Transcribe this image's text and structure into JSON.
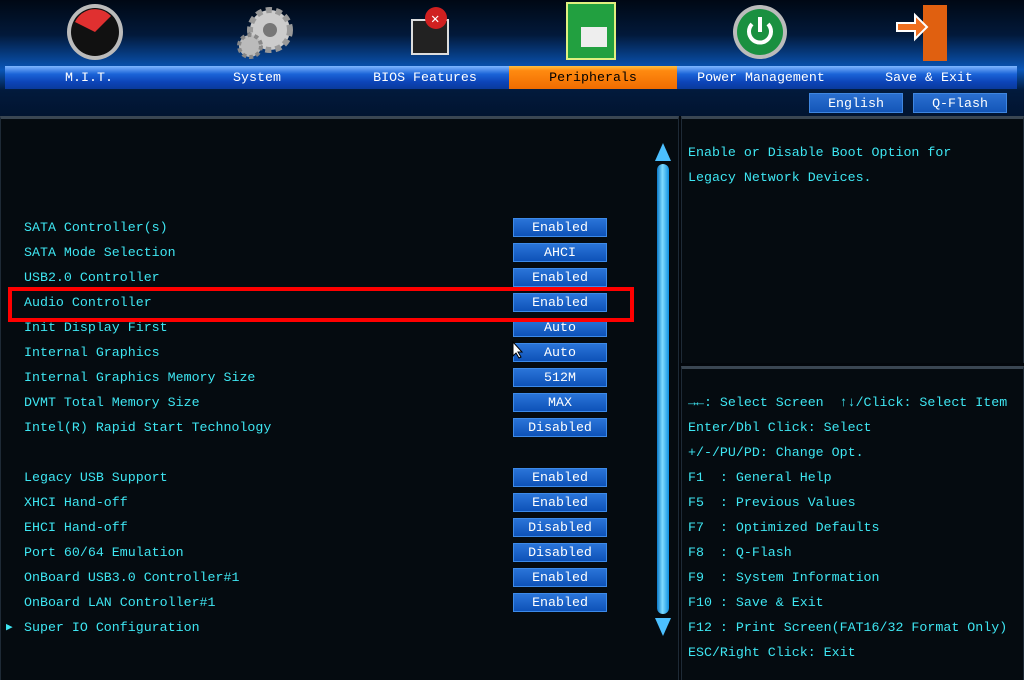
{
  "tabs": [
    {
      "label": "M.I.T.",
      "icon": "speedometer-icon"
    },
    {
      "label": "System",
      "icon": "gears-icon"
    },
    {
      "label": "BIOS Features",
      "icon": "chip-icon"
    },
    {
      "label": "Peripherals",
      "icon": "peripheral-card-icon",
      "active": true
    },
    {
      "label": "Power Management",
      "icon": "power-icon"
    },
    {
      "label": "Save & Exit",
      "icon": "exit-door-icon"
    }
  ],
  "header_buttons": {
    "language": "English",
    "qflash": "Q-Flash"
  },
  "settings": [
    {
      "label": "SATA Controller(s)",
      "value": "Enabled"
    },
    {
      "label": "SATA Mode Selection",
      "value": "AHCI"
    },
    {
      "label": "USB2.0 Controller",
      "value": "Enabled"
    },
    {
      "label": "Audio Controller",
      "value": "Enabled",
      "highlighted": true
    },
    {
      "label": "Init Display First",
      "value": "Auto"
    },
    {
      "label": "Internal Graphics",
      "value": "Auto"
    },
    {
      "label": "Internal Graphics Memory Size",
      "value": "512M"
    },
    {
      "label": "DVMT Total Memory Size",
      "value": "MAX"
    },
    {
      "label": "Intel(R) Rapid Start Technology",
      "value": "Disabled"
    },
    {
      "label": "Legacy USB Support",
      "value": "Enabled"
    },
    {
      "label": "XHCI Hand-off",
      "value": "Enabled"
    },
    {
      "label": "EHCI Hand-off",
      "value": "Disabled"
    },
    {
      "label": "Port 60/64 Emulation",
      "value": "Disabled"
    },
    {
      "label": "OnBoard USB3.0 Controller#1",
      "value": "Enabled"
    },
    {
      "label": "OnBoard LAN Controller#1",
      "value": "Enabled"
    }
  ],
  "submenu": "Super IO Configuration",
  "description": [
    "Enable or Disable Boot Option for",
    "Legacy Network Devices."
  ],
  "key_help": [
    "→←: Select Screen  ↑↓/Click: Select Item",
    "Enter/Dbl Click: Select",
    "+/-/PU/PD: Change Opt.",
    "F1  : General Help",
    "F5  : Previous Values",
    "F7  : Optimized Defaults",
    "F8  : Q-Flash",
    "F9  : System Information",
    "F10 : Save & Exit",
    "F12 : Print Screen(FAT16/32 Format Only)",
    "ESC/Right Click: Exit"
  ],
  "colors": {
    "text": "#3ee6f2",
    "highlight_box": "#ff0000",
    "active_tab": "#f07000"
  }
}
